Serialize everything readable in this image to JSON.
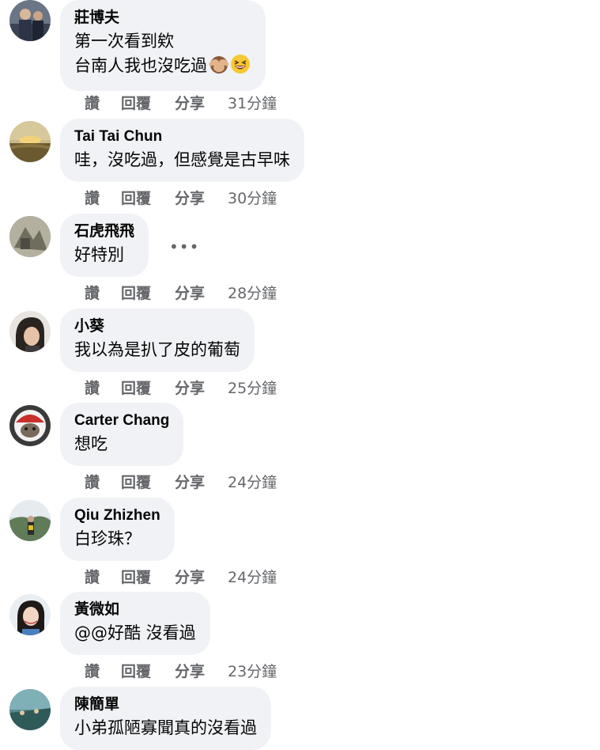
{
  "actions": {
    "like": "讚",
    "reply": "回覆",
    "share": "分享"
  },
  "more_menu": "•••",
  "comments": [
    {
      "author": "莊博夫",
      "lines": [
        "第一次看到欸",
        "台南人我也沒吃過"
      ],
      "emojis": [
        "see-no-evil-monkey-emoji",
        "laughing-face-emoji"
      ],
      "time": "31分鐘"
    },
    {
      "author": "Tai Tai Chun",
      "lines": [
        "哇，沒吃過，但感覺是古早味"
      ],
      "time": "30分鐘"
    },
    {
      "author": "石虎飛飛",
      "lines": [
        "好特別"
      ],
      "time": "28分鐘"
    },
    {
      "author": "小葵",
      "lines": [
        "我以為是扒了皮的葡萄"
      ],
      "time": "25分鐘"
    },
    {
      "author": "Carter Chang",
      "lines": [
        "想吃"
      ],
      "time": "24分鐘"
    },
    {
      "author": "Qiu Zhizhen",
      "lines": [
        "白珍珠？"
      ],
      "time": "24分鐘"
    },
    {
      "author": "黃微如",
      "lines": [
        "@@好酷 沒看過"
      ],
      "time": "23分鐘"
    },
    {
      "author": "陳簡單",
      "lines": [
        "小弟孤陋寡聞真的沒看過"
      ],
      "time": ""
    }
  ]
}
